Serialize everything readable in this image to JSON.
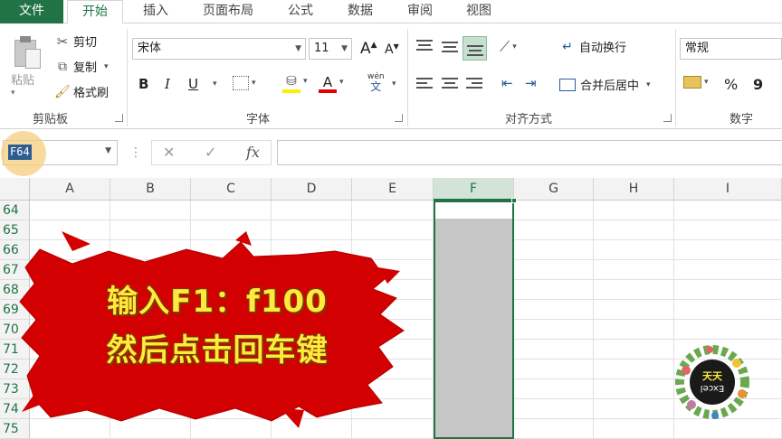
{
  "ribbon_tabs": {
    "file": "文件",
    "home": "开始",
    "insert": "插入",
    "page_layout": "页面布局",
    "formulas": "公式",
    "data": "数据",
    "review": "审阅",
    "view": "视图"
  },
  "clipboard": {
    "paste": "粘贴",
    "cut": "剪切",
    "copy": "复制",
    "format_painter": "格式刷",
    "group_label": "剪贴板"
  },
  "font": {
    "name": "宋体",
    "size": "11",
    "grow": "A",
    "shrink": "A",
    "bold": "B",
    "italic": "I",
    "underline": "U",
    "font_color_letter": "A",
    "phonetic_top": "wén",
    "phonetic_bottom": "文",
    "group_label": "字体"
  },
  "alignment": {
    "wrap_text": "自动换行",
    "merge_center": "合并后居中",
    "group_label": "对齐方式"
  },
  "number": {
    "format": "常规",
    "percent": "%",
    "comma": "9",
    "group_label": "数字"
  },
  "formula_bar": {
    "name_box": "F64",
    "more": "⋮",
    "cancel": "✕",
    "enter": "✓",
    "fx": "fx",
    "formula": ""
  },
  "columns": [
    "A",
    "B",
    "C",
    "D",
    "E",
    "F",
    "G",
    "H",
    "I"
  ],
  "selected_column": "F",
  "rows": [
    "64",
    "65",
    "66",
    "67",
    "68",
    "69",
    "70",
    "71",
    "72",
    "73",
    "74",
    "75"
  ],
  "banner": {
    "line1": "输入F1：f100",
    "line2": "然后点击回车键"
  },
  "logo": {
    "line1": "天天",
    "line2": "Excel"
  },
  "colors": {
    "excel_green": "#217346",
    "banner_red": "#d20000",
    "banner_text": "#ffe93d",
    "selection_fill": "#c6c6c6"
  }
}
